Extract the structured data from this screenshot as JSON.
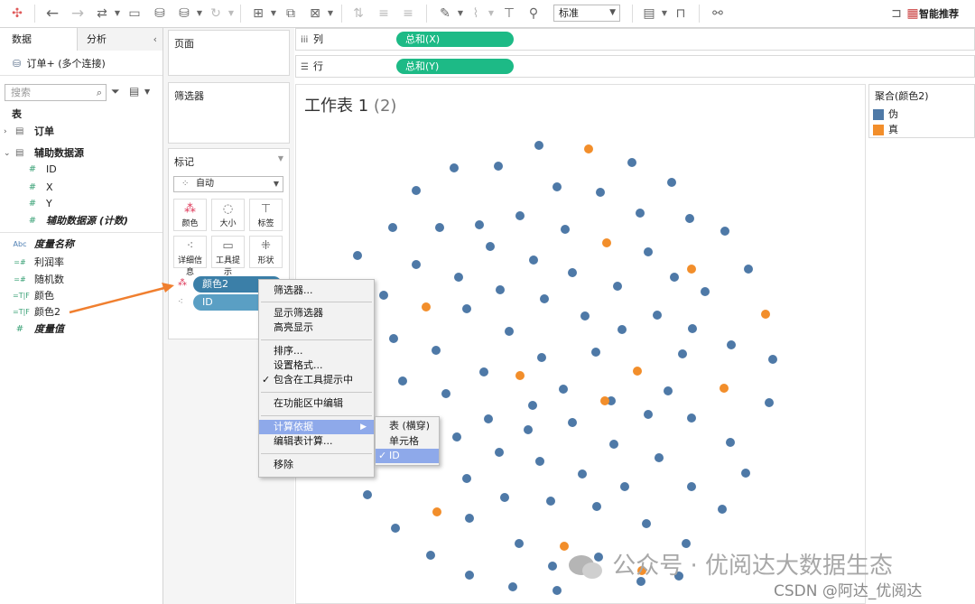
{
  "toolbar": {
    "format_select": "标准",
    "smart_recommend": "智能推荐",
    "icons": [
      "logo-icon",
      "undo-icon",
      "redo-icon",
      "redo-dropdown-icon",
      "save-icon",
      "add-datasource-icon",
      "datasource-dropdown-icon",
      "refresh-icon",
      "new-sheet-icon",
      "duplicate-sheet-icon",
      "clear-sheet-icon",
      "swap-icon",
      "sort-asc-icon",
      "sort-desc-icon",
      "highlight-icon",
      "pin-icon",
      "label-icon",
      "fix-axes-icon",
      "fit-icon",
      "presentation-icon",
      "share-icon",
      "device-preview-icon"
    ]
  },
  "data_pane": {
    "tab_data": "数据",
    "tab_analysis": "分析",
    "datasource": "订单+ (多个连接)",
    "search_placeholder": "搜索",
    "section_tables": "表",
    "table_orders": "订单",
    "table_aux": "辅助数据源",
    "fields_aux": [
      "ID",
      "X",
      "Y",
      "辅助数据源 (计数)"
    ],
    "measure_names": "度量名称",
    "calc_fields": [
      "利润率",
      "随机数",
      "颜色",
      "颜色2"
    ],
    "measure_values": "度量值"
  },
  "cards": {
    "pages": "页面",
    "filters": "筛选器",
    "marks": "标记",
    "mark_type": "自动",
    "mark_buttons": [
      "颜色",
      "大小",
      "标签",
      "详细信息",
      "工具提示",
      "形状"
    ],
    "mark_pills": [
      "颜色2",
      "ID"
    ]
  },
  "shelves": {
    "columns_label": "列",
    "columns_pill": "总和(X)",
    "rows_label": "行",
    "rows_pill": "总和(Y)"
  },
  "view": {
    "title": "工作表 1",
    "title_suffix": "(2)"
  },
  "legend": {
    "title": "聚合(颜色2)",
    "items": [
      {
        "label": "伪",
        "color": "#4e79a7"
      },
      {
        "label": "真",
        "color": "#f28e2b"
      }
    ]
  },
  "context_menu": {
    "items": [
      "筛选器...",
      "显示筛选器",
      "高亮显示",
      "排序...",
      "设置格式...",
      "包含在工具提示中",
      "在功能区中编辑",
      "计算依据",
      "编辑表计算...",
      "移除"
    ],
    "submenu": [
      "表 (横穿)",
      "单元格",
      "ID"
    ]
  },
  "watermark": {
    "text": "公众号 · 优阅达大数据生态",
    "csdn": "CSDN @阿达_优阅达"
  },
  "colors": {
    "pill_green": "#1dba86",
    "mark_pill_blue": "#3b7fa8",
    "dot_blue": "#4e79a7",
    "dot_orange": "#f28e2b",
    "menu_highlight": "#8ea9ea",
    "arrow": "#f07f2f"
  }
}
